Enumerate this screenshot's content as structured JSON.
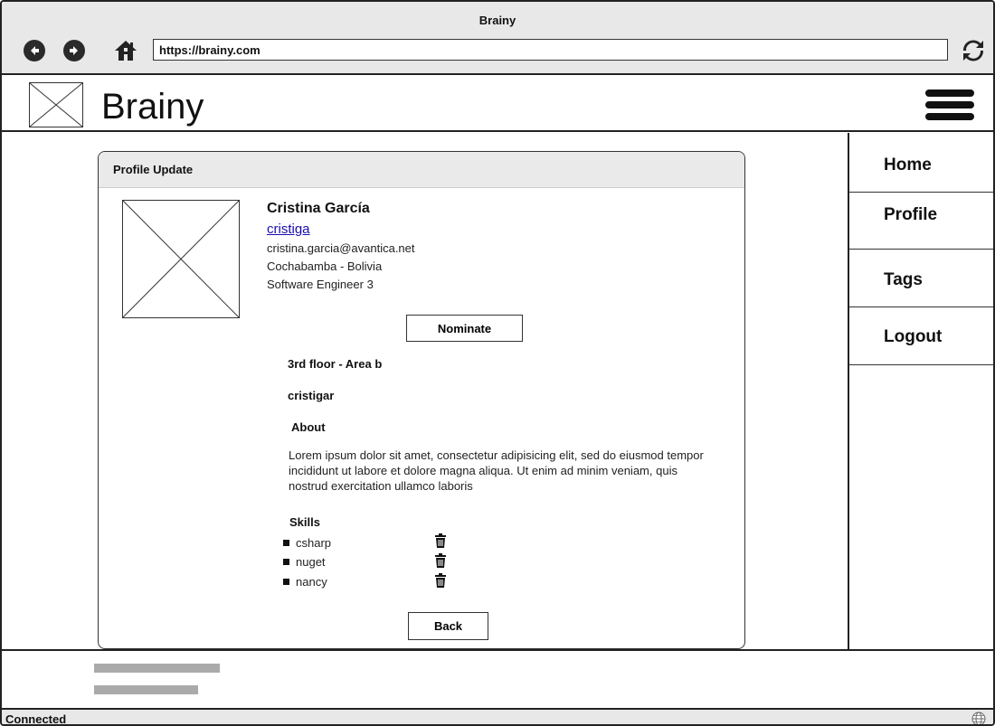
{
  "browser": {
    "title": "Brainy",
    "url": "https://brainy.com"
  },
  "app": {
    "brand": "Brainy"
  },
  "nav": {
    "items": [
      "Home",
      "Profile",
      "Tags",
      "Logout"
    ]
  },
  "panel": {
    "title": "Profile Update",
    "name": "Cristina García",
    "username_link": "cristiga",
    "email": "cristina.garcia@avantica.net",
    "location": "Cochabamba - Bolivia",
    "role": "Software Engineer 3",
    "nominate_label": "Nominate",
    "office": "3rd floor - Area b",
    "handle": "cristigar",
    "about_heading": "About",
    "about_text": "Lorem ipsum dolor sit amet, consectetur adipisicing elit, sed do eiusmod tempor incididunt ut labore et dolore magna aliqua. Ut enim ad minim veniam, quis nostrud exercitation ullamco laboris",
    "skills_heading": "Skills",
    "skills": [
      "csharp",
      "nuget",
      "nancy"
    ],
    "back_label": "Back"
  },
  "status": {
    "text": "Connected"
  },
  "icons": {
    "back": "arrow-left-icon",
    "forward": "arrow-right-icon",
    "home": "home-icon",
    "reload": "reload-icon",
    "menu": "hamburger-menu-icon",
    "delete": "trash-icon",
    "globe": "globe-icon"
  }
}
